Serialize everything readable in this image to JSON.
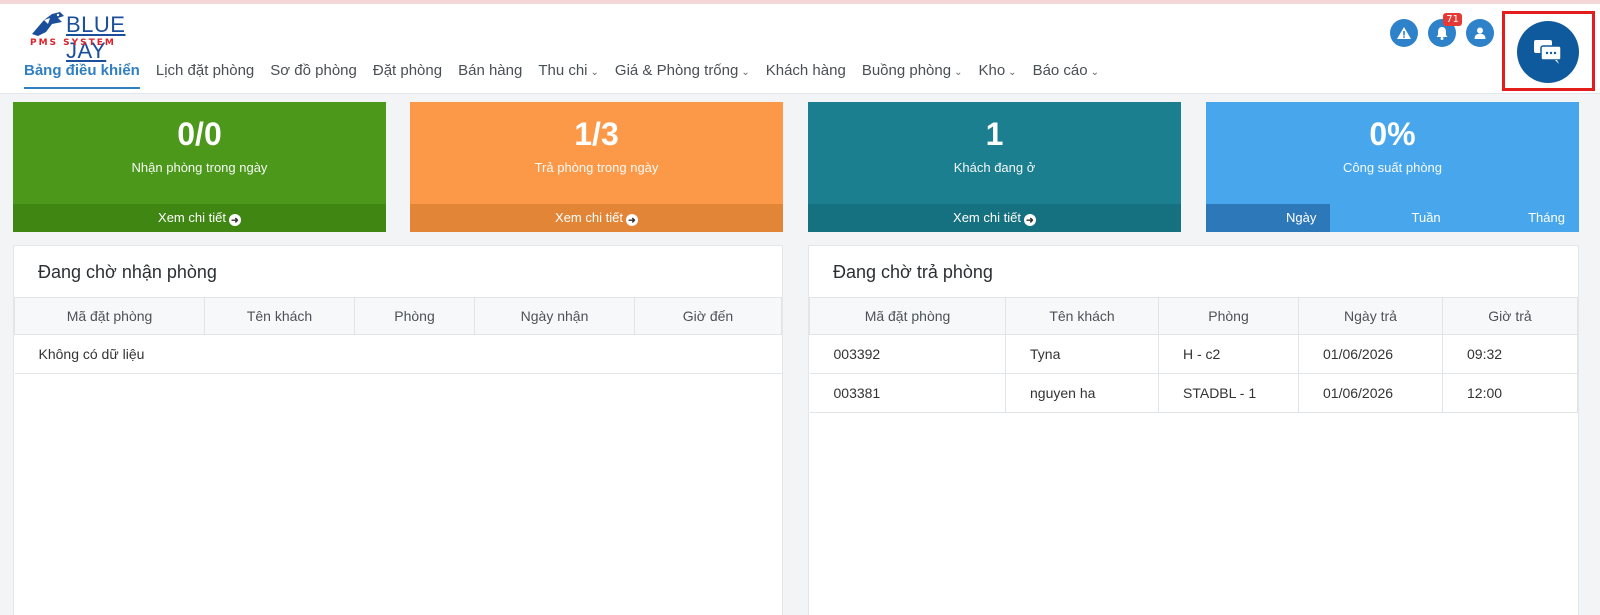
{
  "logo": {
    "name": "BLUE JAY",
    "sub": "PMS SYSTEM"
  },
  "nav": [
    {
      "label": "Bảng điều khiển",
      "dropdown": false,
      "active": true
    },
    {
      "label": "Lịch đặt phòng",
      "dropdown": false
    },
    {
      "label": "Sơ đồ phòng",
      "dropdown": false
    },
    {
      "label": "Đặt phòng",
      "dropdown": false
    },
    {
      "label": "Bán hàng",
      "dropdown": false
    },
    {
      "label": "Thu chi",
      "dropdown": true
    },
    {
      "label": "Giá & Phòng trống",
      "dropdown": true
    },
    {
      "label": "Khách hàng",
      "dropdown": false
    },
    {
      "label": "Buồng phòng",
      "dropdown": true
    },
    {
      "label": "Kho",
      "dropdown": true
    },
    {
      "label": "Báo cáo",
      "dropdown": true
    }
  ],
  "header_icons": {
    "warning": "warning-icon",
    "notification": "bell-icon",
    "notification_count": "71",
    "user": "user-icon",
    "chat": "chat-icon"
  },
  "cards": {
    "checkin": {
      "value": "0/0",
      "label": "Nhận phòng trong ngày",
      "link": "Xem chi tiết"
    },
    "checkout": {
      "value": "1/3",
      "label": "Trả phòng trong ngày",
      "link": "Xem chi tiết"
    },
    "staying": {
      "value": "1",
      "label": "Khách đang ở",
      "link": "Xem chi tiết"
    },
    "occupancy": {
      "value": "0%",
      "label": "Công suất phòng",
      "tabs": [
        "Ngày",
        "Tuần",
        "Tháng"
      ]
    }
  },
  "waiting_checkin": {
    "title": "Đang chờ nhận phòng",
    "columns": [
      "Mã đặt phòng",
      "Tên khách",
      "Phòng",
      "Ngày nhận",
      "Giờ đến"
    ],
    "empty_text": "Không có dữ liệu"
  },
  "waiting_checkout": {
    "title": "Đang chờ trả phòng",
    "columns": [
      "Mã đặt phòng",
      "Tên khách",
      "Phòng",
      "Ngày trả",
      "Giờ trả"
    ],
    "rows": [
      [
        "003392",
        "Tyna",
        "H - c2",
        "01/06/2026",
        "09:32"
      ],
      [
        "003381",
        "nguyen ha",
        "STADBL - 1",
        "01/06/2026",
        "12:00"
      ]
    ]
  },
  "colors": {
    "brand": "#2f7fc1",
    "card_green": "#4b981a",
    "card_orange": "#fc9948",
    "card_teal": "#1b7f8f",
    "card_blue": "#48a7ec",
    "highlight_frame": "#e31c1c"
  }
}
